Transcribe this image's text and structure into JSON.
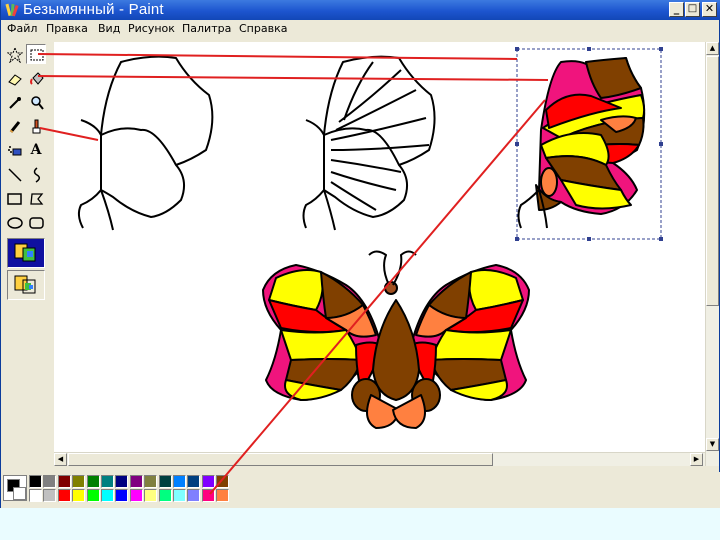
{
  "window": {
    "title": "Безымянный - Paint",
    "buttons": {
      "minimize": "_",
      "maximize": "□",
      "close": "✕"
    }
  },
  "menu": {
    "items": [
      "Файл",
      "Правка",
      "Вид",
      "Рисунок",
      "Палитра",
      "Справка"
    ]
  },
  "toolbox": {
    "tools": [
      {
        "name": "free-select-tool",
        "icon": "star-select-icon"
      },
      {
        "name": "rect-select-tool",
        "icon": "rect-select-icon"
      },
      {
        "name": "eraser-tool",
        "icon": "eraser-icon"
      },
      {
        "name": "fill-tool",
        "icon": "paint-bucket-icon"
      },
      {
        "name": "pick-color-tool",
        "icon": "eyedropper-icon"
      },
      {
        "name": "magnifier-tool",
        "icon": "magnifier-icon"
      },
      {
        "name": "pencil-tool",
        "icon": "pencil-icon"
      },
      {
        "name": "brush-tool",
        "icon": "brush-icon"
      },
      {
        "name": "airbrush-tool",
        "icon": "airbrush-icon"
      },
      {
        "name": "text-tool",
        "icon": "text-icon",
        "glyph": "A"
      },
      {
        "name": "line-tool",
        "icon": "line-icon"
      },
      {
        "name": "curve-tool",
        "icon": "curve-icon"
      },
      {
        "name": "rectangle-tool",
        "icon": "rectangle-icon"
      },
      {
        "name": "polygon-tool",
        "icon": "polygon-icon"
      },
      {
        "name": "ellipse-tool",
        "icon": "ellipse-icon"
      },
      {
        "name": "rounded-rect-tool",
        "icon": "rounded-rect-icon"
      }
    ],
    "selected_tool": "rect-select-tool"
  },
  "palette": {
    "foreground": "#000000",
    "background": "#ffffff",
    "top_row": [
      "#000000",
      "#808080",
      "#800000",
      "#808000",
      "#008000",
      "#008080",
      "#000080",
      "#800080",
      "#808040",
      "#004040",
      "#0080ff",
      "#004080",
      "#8000ff",
      "#804000"
    ],
    "bottom_row": [
      "#ffffff",
      "#c0c0c0",
      "#ff0000",
      "#ffff00",
      "#00ff00",
      "#00ffff",
      "#0000ff",
      "#ff00ff",
      "#ffff80",
      "#00ff80",
      "#80ffff",
      "#8080ff",
      "#ff0080",
      "#ff8040"
    ]
  },
  "colors": {
    "pink": "#f0147d",
    "yellow": "#ffff00",
    "red": "#ff0000",
    "brown": "#804000",
    "orange": "#ff8040",
    "annotation": "#e02020"
  }
}
